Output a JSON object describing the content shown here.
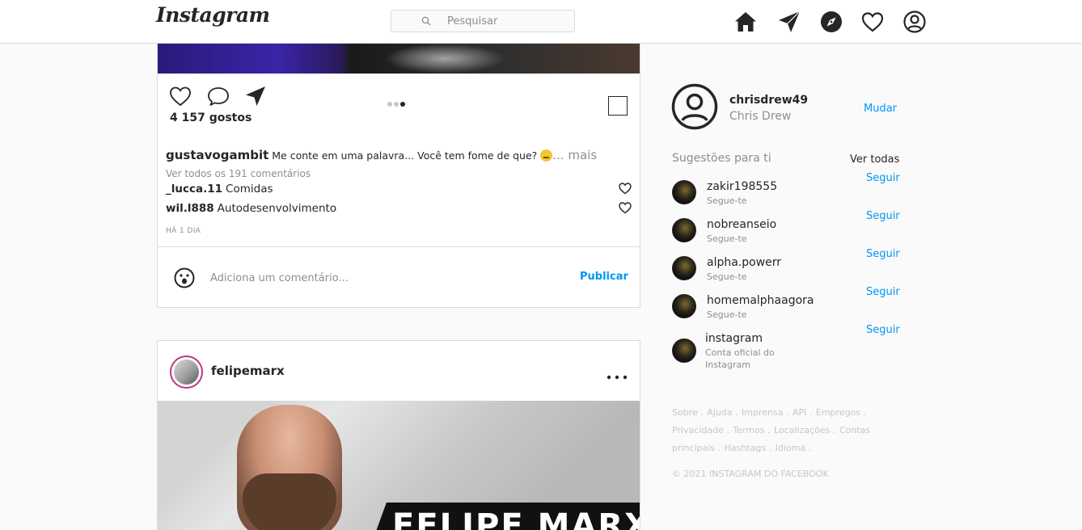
{
  "header": {
    "logo": "Instagram",
    "search_placeholder": "Pesquisar"
  },
  "post1": {
    "likes": "4 157 gostos",
    "caption_user": "gustavogambit",
    "caption_text": "Me conte em uma palavra... Você tem fome de que?",
    "more": "... mais",
    "view_comments": "Ver todos os 191 comentários",
    "comments": [
      {
        "user": "_lucca.11",
        "text": "Comidas"
      },
      {
        "user": "wil.l888",
        "text": "Autodesenvolvimento"
      }
    ],
    "time": "HÁ 1 DIA",
    "comment_placeholder": "Adiciona um comentário...",
    "publish": "Publicar"
  },
  "post2": {
    "user": "felipemarx",
    "image_text": "FELIPE MARX"
  },
  "sidebar": {
    "username": "chrisdrew49",
    "name": "Chris Drew",
    "switch": "Mudar",
    "suggestions_title": "Sugestões para ti",
    "see_all": "Ver todas",
    "suggestions": [
      {
        "name": "zakir198555",
        "sub": "Segue-te",
        "action": "Seguir"
      },
      {
        "name": "nobreanseio",
        "sub": "Segue-te",
        "action": "Seguir"
      },
      {
        "name": "alpha.powerr",
        "sub": "Segue-te",
        "action": "Seguir"
      },
      {
        "name": "homemalphaagora",
        "sub": "Segue-te",
        "action": "Seguir"
      },
      {
        "name": "instagram",
        "sub": "Conta oficial do Instagram",
        "action": "Seguir"
      }
    ],
    "footer_links": [
      "Sobre .",
      "Ajuda .",
      "Imprensa .",
      "API .",
      "Empregos .",
      "Privacidade .",
      "Termos .",
      "Localizações .",
      "Contas principais .",
      "Hashtags .",
      "Idioma ."
    ],
    "copyright": "© 2021 INSTAGRAM DO FACEBOOK"
  },
  "colors": {
    "accent": "#0095f6",
    "muted": "#8e8e8e",
    "border": "#dbdbdb"
  },
  "icons": [
    "home-icon",
    "direct-icon",
    "explore-icon",
    "activity-heart-icon",
    "profile-icon",
    "search-icon",
    "like-icon",
    "comment-icon",
    "share-icon",
    "save-icon",
    "emoji-icon",
    "more-options-icon"
  ]
}
